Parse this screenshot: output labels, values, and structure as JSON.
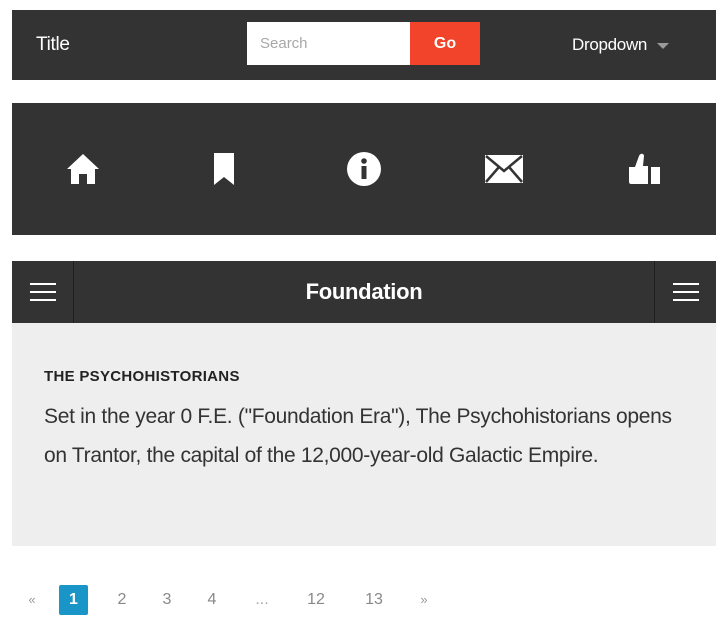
{
  "header": {
    "title": "Title",
    "search_placeholder": "Search",
    "go_label": "Go",
    "dropdown_label": "Dropdown"
  },
  "icon_bar": {
    "icons": [
      "home-icon",
      "bookmark-icon",
      "info-icon",
      "envelope-icon",
      "thumbs-up-icon"
    ]
  },
  "panel": {
    "title": "Foundation",
    "chapter_title": "THE PSYCHOHISTORIANS",
    "description": "Set in the year 0 F.E. (\"Foundation Era\"), The Psychohistorians opens on Trantor, the capital of the 12,000-year-old Galactic Empire."
  },
  "pagination": {
    "prev": "«",
    "pages": [
      "1",
      "2",
      "3",
      "4",
      "...",
      "12",
      "13"
    ],
    "next": "»",
    "current": "1"
  },
  "colors": {
    "bar_background": "#333333",
    "go_button": "#f1442a",
    "panel_body": "#eeeeee",
    "active_page": "#1a95c8"
  }
}
